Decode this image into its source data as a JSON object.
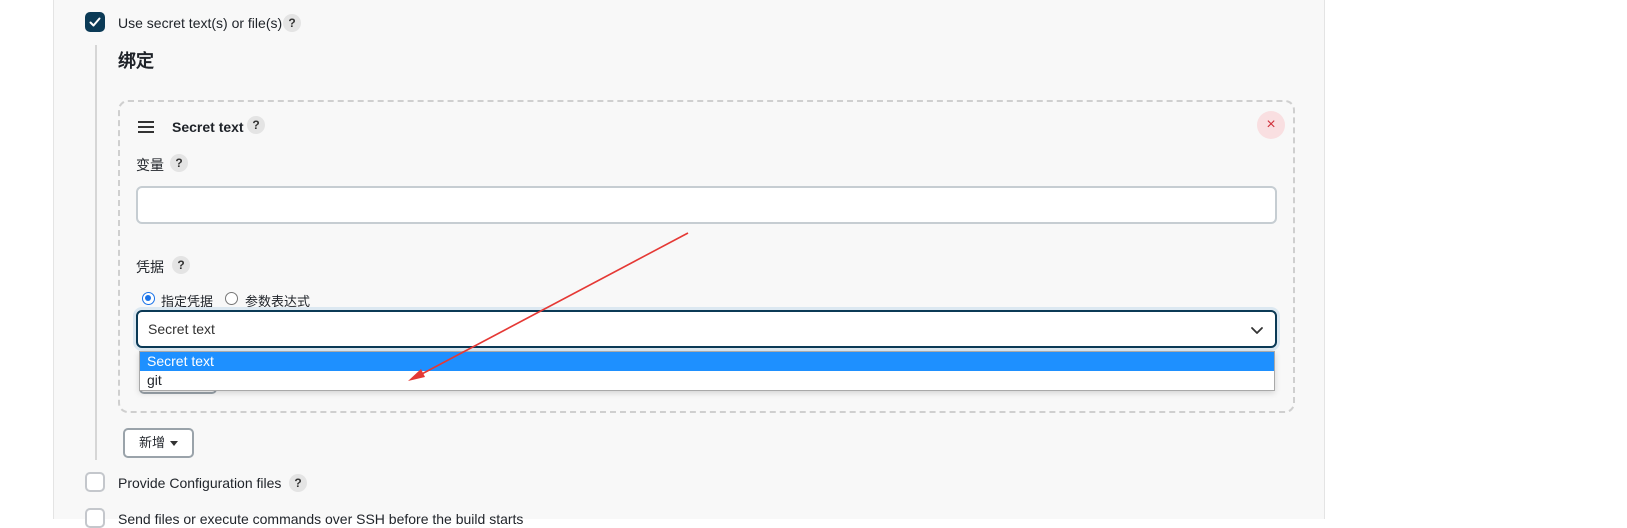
{
  "options": {
    "use_secret": {
      "label": "Use secret text(s) or file(s)",
      "checked": true
    },
    "provide_config": {
      "label": "Provide Configuration files",
      "checked": false
    },
    "send_files": {
      "label": "Send files or execute commands over SSH before the build starts",
      "checked": false
    }
  },
  "help_glyph": "?",
  "bindings": {
    "section_title": "绑定",
    "card": {
      "title": "Secret text",
      "remove_glyph": "×",
      "variable": {
        "label": "变量",
        "value": "",
        "placeholder": ""
      },
      "credentials": {
        "label": "凭据",
        "radio_specific": "指定凭据",
        "radio_expression": "参数表达式",
        "selected_radio": "指定凭据",
        "select_value": "Secret text",
        "dropdown_options": [
          "Secret text",
          "git"
        ],
        "highlighted_option": "Secret text"
      }
    },
    "add_button": "新增"
  },
  "annotation": {
    "type": "red-arrow",
    "color": "#e53935"
  },
  "colors": {
    "accent": "#0b3a56",
    "option_highlight": "#1e90ff",
    "remove": "#d0313b"
  }
}
